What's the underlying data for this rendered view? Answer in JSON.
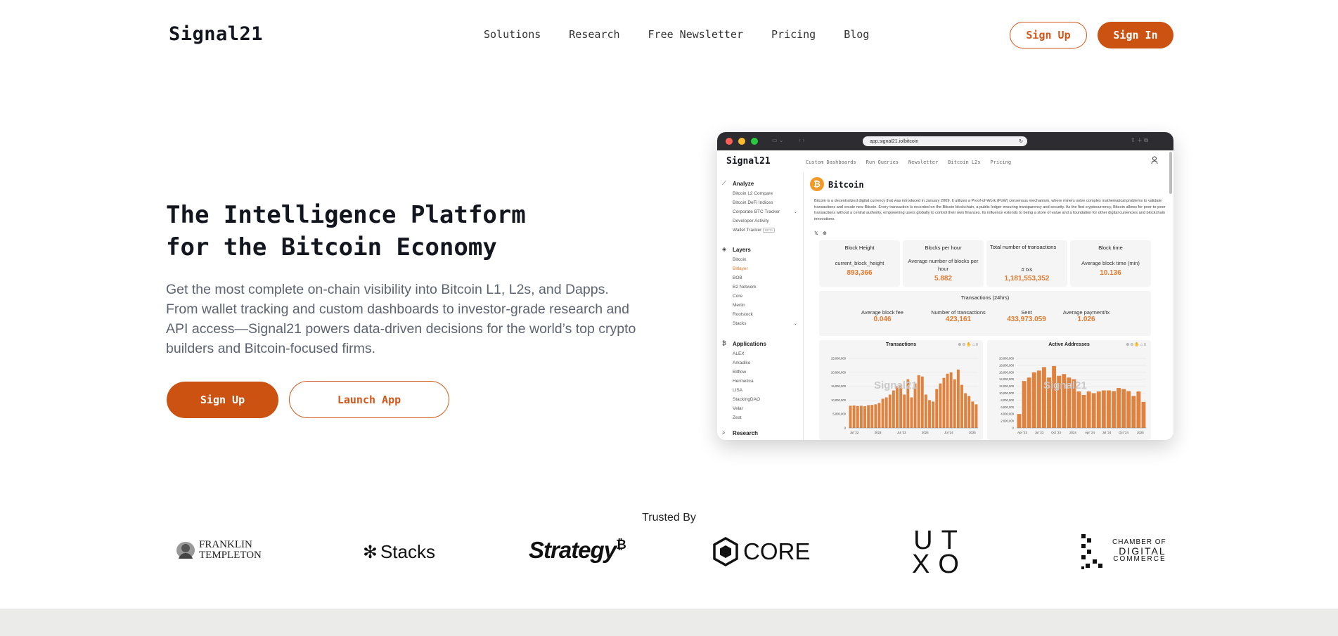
{
  "brand": {
    "name": "Signal21",
    "accent": "#cc5211"
  },
  "nav": {
    "links": [
      "Solutions",
      "Research",
      "Free Newsletter",
      "Pricing",
      "Blog"
    ],
    "sign_up": "Sign Up",
    "sign_in": "Sign In"
  },
  "hero": {
    "title_line1": "The Intelligence Platform",
    "title_line2": "for the Bitcoin Economy",
    "subtitle": "Get the most complete on-chain visibility into Bitcoin L1, L2s, and Dapps. From wallet tracking and custom dashboards to investor-grade research and API access—Signal21 powers data-driven decisions for the world’s top crypto builders and Bitcoin-focused firms.",
    "cta_primary": "Sign Up",
    "cta_secondary": "Launch App"
  },
  "mockup": {
    "url": "app.signal21.io/bitcoin",
    "logo": "Signal21",
    "nav_links": [
      "Custom Dashboards",
      "Run Queries",
      "Newsletter",
      "Bitcoin L2s",
      "Pricing"
    ],
    "sidebar": {
      "analyze": {
        "heading": "Analyze",
        "items": [
          "Bitcoin L2 Compare",
          "Bitcoin DeFi Indices",
          "Corporate BTC Tracker",
          "Developer Activity",
          "Wallet Tracker"
        ],
        "badge": "BETA"
      },
      "layers": {
        "heading": "Layers",
        "items": [
          "Bitcoin",
          "Bitlayer",
          "BOB",
          "B2 Network",
          "Core",
          "Merlin",
          "Rootstock",
          "Stacks"
        ],
        "active": "Bitlayer"
      },
      "applications": {
        "heading": "Applications",
        "items": [
          "ALEX",
          "Arkadiko",
          "Bitflow",
          "Hermetica",
          "LISA",
          "StackingDAO",
          "Velar",
          "Zest"
        ]
      },
      "research": {
        "heading": "Research"
      }
    },
    "page_title": "Bitcoin",
    "description": "Bitcoin is a decentralized digital currency that was introduced in January 2009. It utilizes a Proof-of-Work (PoW) consensus mechanism, where miners solve complex mathematical problems to validate transactions and create new Bitcoin. Every transaction is recorded on the Bitcoin blockchain, a public ledger ensuring transparency and security. As the first cryptocurrency, Bitcoin allows for peer-to-peer transactions without a central authority, empowering users globally to control their own finances. Its influence extends to being a store of value and a foundation for other digital currencies and blockchain innovations.",
    "stats": [
      {
        "title": "Block Height",
        "label": "current_block_height",
        "value": "893,366"
      },
      {
        "title": "Blocks per hour",
        "label": "Average number of blocks per hour",
        "value": "5.882"
      },
      {
        "title": "Total number of transactions",
        "label": "# txs",
        "value": "1,181,553,352"
      },
      {
        "title": "Block time",
        "label": "Average block time (min)",
        "value": "10.136"
      }
    ],
    "tx24": {
      "title": "Transactions (24hrs)",
      "items": [
        {
          "label": "Average block fee",
          "value": "0.046"
        },
        {
          "label": "Number of transactions",
          "value": "423,161"
        },
        {
          "label": "Sent",
          "value": "433,973.059"
        },
        {
          "label": "Average payment/tx",
          "value": "1.026"
        }
      ]
    },
    "watermark": "Signal21"
  },
  "chart_data": [
    {
      "type": "bar",
      "title": "Transactions",
      "color": "#e0813e",
      "ylim": [
        0,
        25000000
      ],
      "yticks": [
        "25,000,000",
        "20,000,000",
        "15,000,000",
        "10,000,000",
        "5,000,000",
        "0"
      ],
      "xticks": [
        "Jul '22",
        "2023",
        "Jul '23",
        "2024",
        "Jul '24",
        "2025"
      ],
      "values": [
        8000000,
        8100000,
        7900000,
        8000000,
        7800000,
        8200000,
        8300000,
        8500000,
        9000000,
        10500000,
        11000000,
        12000000,
        13500000,
        15000000,
        15500000,
        12000000,
        17500000,
        11000000,
        16000000,
        19000000,
        18500000,
        12000000,
        10000000,
        9500000,
        14000000,
        16000000,
        18000000,
        19500000,
        20000000,
        17500000,
        21000000,
        15500000,
        12500000,
        11500000,
        9500000,
        8500000
      ]
    },
    {
      "type": "bar",
      "title": "Active Addresses",
      "color": "#e0813e",
      "ylim": [
        0,
        20000000
      ],
      "yticks": [
        "20,000,000",
        "18,000,000",
        "16,000,000",
        "14,000,000",
        "12,000,000",
        "10,000,000",
        "8,000,000",
        "6,000,000",
        "4,000,000",
        "2,000,000",
        "0"
      ],
      "xticks": [
        "Apr '23",
        "Jul '23",
        "Oct '23",
        "2024",
        "Apr '24",
        "Jul '24",
        "Oct '24",
        "2025"
      ],
      "values": [
        4000000,
        13500000,
        14500000,
        16000000,
        16500000,
        17500000,
        14500000,
        17800000,
        15000000,
        15500000,
        14500000,
        14000000,
        10500000,
        9500000,
        10500000,
        10000000,
        10500000,
        10800000,
        10800000,
        10600000,
        11500000,
        11200000,
        10600000,
        9200000,
        10500000,
        7500000
      ]
    }
  ],
  "trusted": {
    "label": "Trusted By",
    "logos": [
      "FRANKLIN TEMPLETON",
      "Stacks",
      "Strategy",
      "CORE",
      "UTXO",
      "CHAMBER OF DIGITAL COMMERCE"
    ]
  }
}
